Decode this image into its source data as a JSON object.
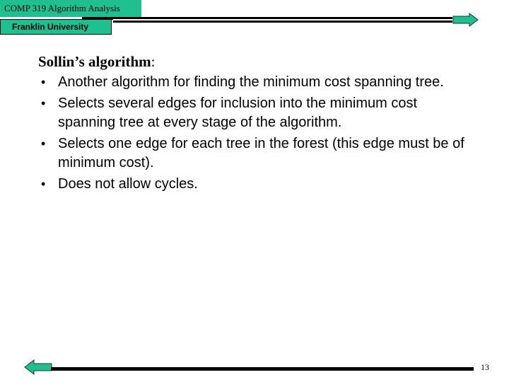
{
  "header": {
    "course": "COMP 319 Algorithm Analysis",
    "university": "Franklin University"
  },
  "colors": {
    "accent": "#1fbf8f",
    "rule": "#000000"
  },
  "navigation": {
    "next_icon": "arrow-right-icon",
    "prev_icon": "arrow-left-icon"
  },
  "slide": {
    "heading_bold": "Sollin’s algorithm",
    "heading_suffix": ":",
    "bullets": [
      {
        "marker": "•",
        "text": "Another algorithm for finding the minimum cost spanning tree."
      },
      {
        "marker": "•",
        "text": "Selects several edges for inclusion into the minimum cost spanning tree at every stage of the algorithm."
      },
      {
        "marker": "•",
        "text": "Selects one edge for each tree in the forest (this edge must be of minimum cost)."
      },
      {
        "marker": "•",
        "text": "Does not allow cycles."
      }
    ]
  },
  "footer": {
    "page_number": "13"
  }
}
